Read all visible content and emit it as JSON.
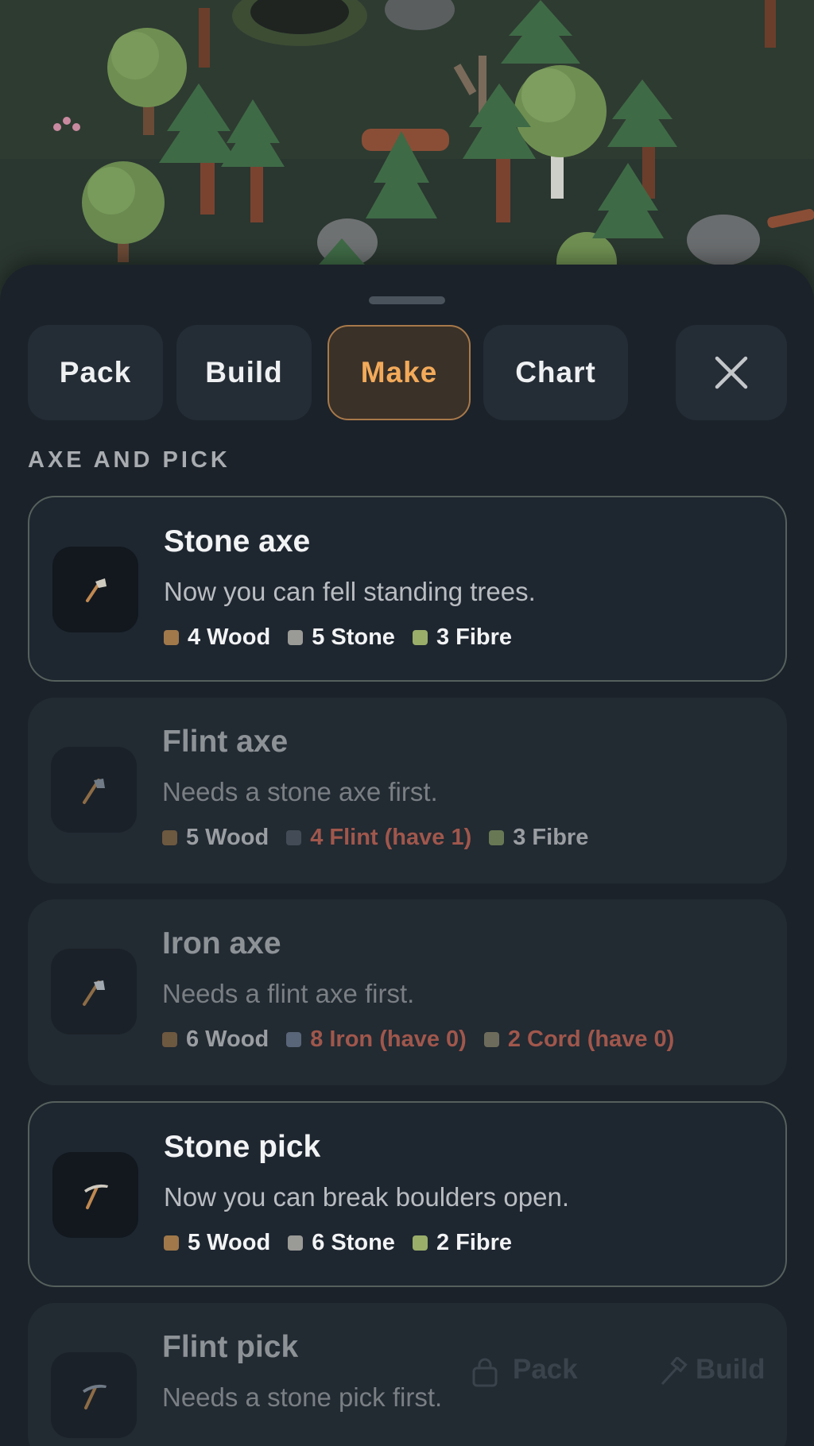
{
  "tabs": [
    {
      "label": "Pack",
      "active": false
    },
    {
      "label": "Build",
      "active": false
    },
    {
      "label": "Make",
      "active": true
    },
    {
      "label": "Chart",
      "active": false
    }
  ],
  "close_icon": "close-icon",
  "section": {
    "title": "AXE AND PICK"
  },
  "recipes": [
    {
      "name": "Stone axe",
      "description": "Now you can fell standing trees.",
      "icon": "stone-axe-icon",
      "state": "available",
      "costs": [
        {
          "label": "4 Wood",
          "color": "#a0784a"
        },
        {
          "label": "5 Stone",
          "color": "#9a9a96"
        },
        {
          "label": "3 Fibre",
          "color": "#9aae6a"
        }
      ]
    },
    {
      "name": "Flint axe",
      "description": "Needs a stone axe first.",
      "icon": "flint-axe-icon",
      "state": "locked",
      "costs": [
        {
          "label": "5 Wood",
          "color": "#a0784a"
        },
        {
          "label": "4 Flint (have 1)",
          "color": "#5a646e",
          "missing": true
        },
        {
          "label": "3 Fibre",
          "color": "#9aae6a"
        }
      ]
    },
    {
      "name": "Iron axe",
      "description": "Needs a flint axe first.",
      "icon": "iron-axe-icon",
      "state": "locked",
      "costs": [
        {
          "label": "6 Wood",
          "color": "#a0784a"
        },
        {
          "label": "8 Iron (have 0)",
          "color": "#7e8ea6",
          "missing": true
        },
        {
          "label": "2 Cord (have 0)",
          "color": "#a09a78",
          "missing": true
        }
      ]
    },
    {
      "name": "Stone pick",
      "description": "Now you can break boulders open.",
      "icon": "stone-pick-icon",
      "state": "available",
      "costs": [
        {
          "label": "5 Wood",
          "color": "#a0784a"
        },
        {
          "label": "6 Stone",
          "color": "#9a9a96"
        },
        {
          "label": "2 Fibre",
          "color": "#9aae6a"
        }
      ]
    },
    {
      "name": "Flint pick",
      "description": "Needs a stone pick first.",
      "icon": "flint-pick-icon",
      "state": "locked",
      "costs": []
    }
  ],
  "nav": [
    {
      "label": "Pack",
      "icon": "bag-icon"
    },
    {
      "label": "Build",
      "icon": "hammer-icon"
    }
  ],
  "colors": {
    "accent": "#f2aa5a",
    "sheet": "#1b222a",
    "missing": "#a0574c"
  }
}
